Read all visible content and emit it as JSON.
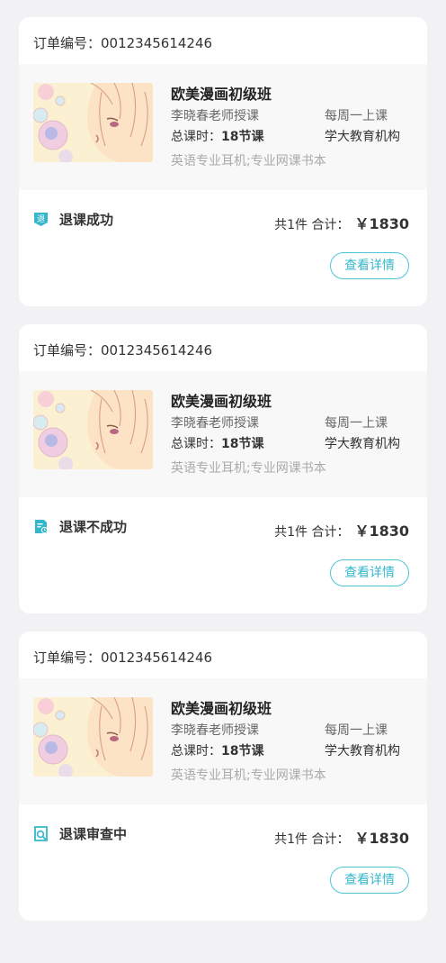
{
  "orders": [
    {
      "order_no": "订单编号：0012345614246",
      "course_title": "欧美漫画初级班",
      "teacher": "李晓春老师授课",
      "hours_label": "总课时：",
      "hours_value": "18节课",
      "schedule": "每周一上课",
      "org": "学大教育机构",
      "extras": "英语专业耳机;专业网课书本",
      "status_icon": "refund-badge-icon",
      "status": "退课成功",
      "count": "共1件",
      "total_label": "合计：",
      "amount": "￥1830",
      "detail_label": "查看详情"
    },
    {
      "order_no": "订单编号：0012345614246",
      "course_title": "欧美漫画初级班",
      "teacher": "李晓春老师授课",
      "hours_label": "总课时：",
      "hours_value": "18节课",
      "schedule": "每周一上课",
      "org": "学大教育机构",
      "extras": "英语专业耳机;专业网课书本",
      "status_icon": "document-clock-icon",
      "status": "退课不成功",
      "count": "共1件",
      "total_label": "合计：",
      "amount": "￥1830",
      "detail_label": "查看详情"
    },
    {
      "order_no": "订单编号：0012345614246",
      "course_title": "欧美漫画初级班",
      "teacher": "李晓春老师授课",
      "hours_label": "总课时：",
      "hours_value": "18节课",
      "schedule": "每周一上课",
      "org": "学大教育机构",
      "extras": "英语专业耳机;专业网课书本",
      "status_icon": "document-search-icon",
      "status": "退课审查中",
      "count": "共1件",
      "total_label": "合计：",
      "amount": "￥1830",
      "detail_label": "查看详情"
    }
  ],
  "colors": {
    "accent": "#35b7cb",
    "page_bg": "#f2f2f4",
    "card_bg": "#ffffff",
    "product_bg": "#f8f8f9"
  }
}
